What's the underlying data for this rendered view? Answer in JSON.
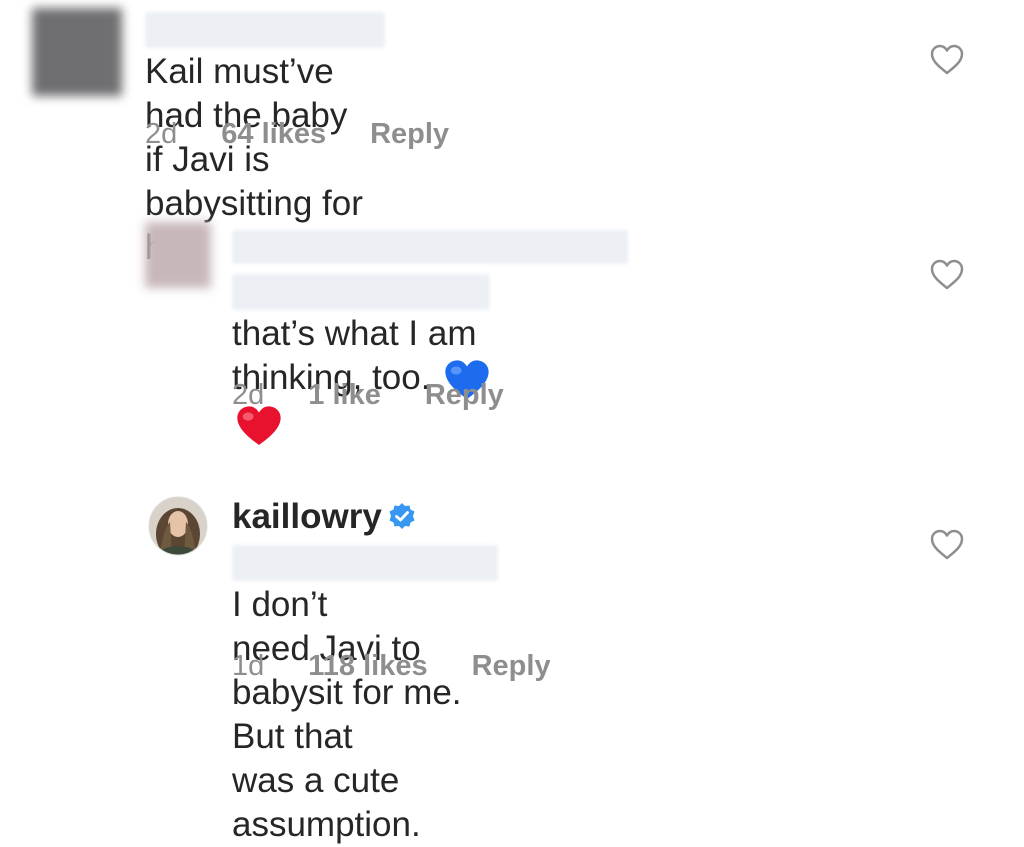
{
  "comments": [
    {
      "text_line1": "Kail must’ve had the baby",
      "text_line2": "if Javi is babysitting for her.",
      "time": "2d",
      "likes": "64 likes",
      "reply": "Reply",
      "icons": {
        "like": "heart-outline-icon"
      }
    },
    {
      "text_line1": "that’s what I am",
      "text_line2": "thinking, too.",
      "emojis": [
        "blue-heart",
        "red-heart"
      ],
      "time": "2d",
      "likes": "1 like",
      "reply": "Reply",
      "icons": {
        "like": "heart-outline-icon"
      }
    },
    {
      "username": "kaillowry",
      "text_line1": "I don’t",
      "text_line2": "need Javi to babysit for me. But that",
      "text_line3": "was a cute assumption.",
      "time": "1d",
      "likes": "118 likes",
      "reply": "Reply",
      "icons": {
        "verified": "verified-badge-icon",
        "like": "heart-outline-icon"
      }
    }
  ],
  "colors": {
    "text": "#262626",
    "meta": "#8e8e8e",
    "verified": "#3897f0",
    "redaction": "#ecf0f5",
    "blue_heart": "#1d6cf0",
    "red_heart": "#e8122e"
  }
}
